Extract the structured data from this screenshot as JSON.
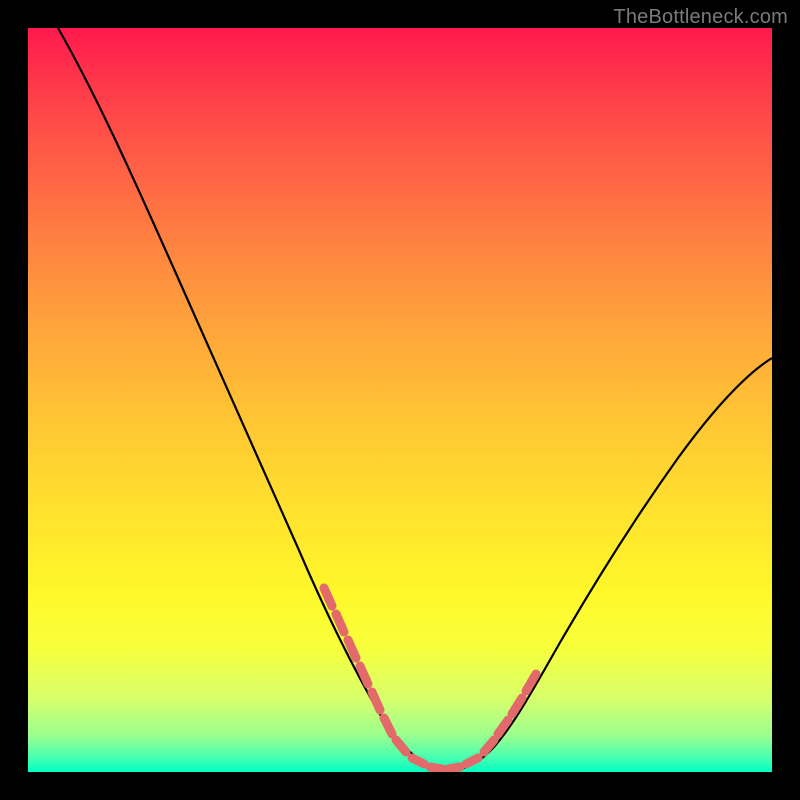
{
  "attribution": "TheBottleneck.com",
  "chart_data": {
    "type": "line",
    "title": "",
    "xlabel": "",
    "ylabel": "",
    "xlim": [
      0,
      100
    ],
    "ylim": [
      0,
      100
    ],
    "grid": false,
    "legend": false,
    "series": [
      {
        "name": "bottleneck-curve",
        "color": "#000000",
        "x": [
          4,
          10,
          17,
          24,
          31,
          38,
          44,
          48,
          51,
          54,
          56,
          58,
          60,
          63,
          68,
          75,
          83,
          91,
          100
        ],
        "y": [
          100,
          87,
          73,
          59,
          45,
          31,
          18,
          10,
          5,
          2,
          1,
          1,
          2,
          5,
          12,
          22,
          33,
          44,
          55
        ]
      }
    ],
    "highlight_band": {
      "name": "near-trough-markers",
      "color": "#e26a6a",
      "x": [
        40,
        42,
        44,
        46,
        48,
        50,
        52,
        54,
        56,
        58,
        60,
        62,
        64,
        65,
        66,
        67
      ],
      "y": [
        25,
        21,
        17,
        13,
        9,
        5,
        3,
        2,
        1,
        1,
        2,
        4,
        6,
        8,
        10,
        12
      ]
    },
    "gradient_stops": [
      {
        "pos": 0,
        "color": "#ff1a4d"
      },
      {
        "pos": 50,
        "color": "#ffc933"
      },
      {
        "pos": 85,
        "color": "#f8ff3a"
      },
      {
        "pos": 100,
        "color": "#00ffc3"
      }
    ]
  }
}
